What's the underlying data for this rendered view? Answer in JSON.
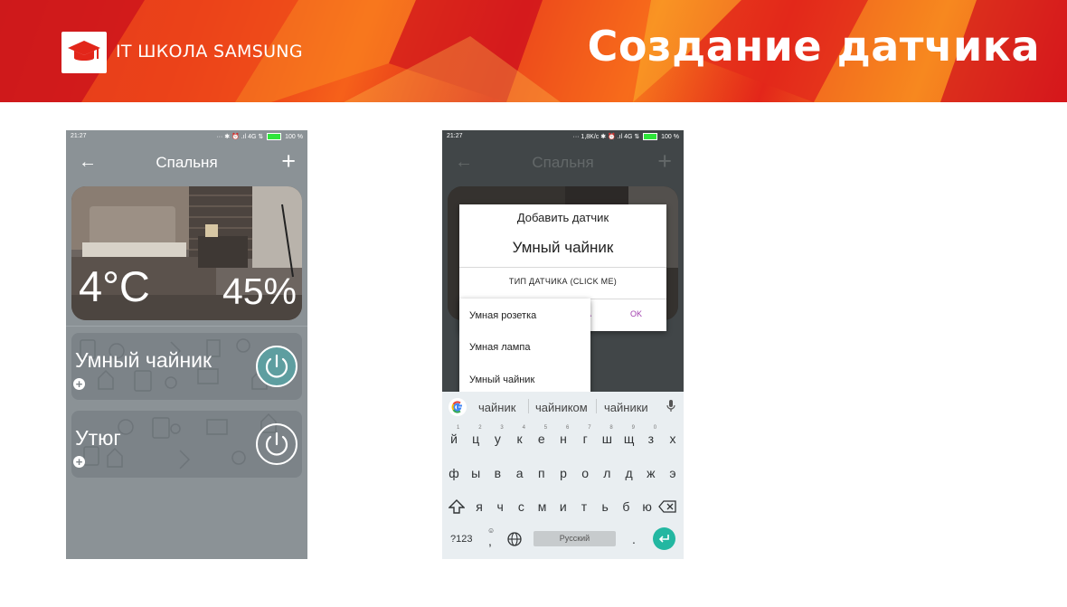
{
  "header": {
    "logo_text": "IT ШКОЛА SAMSUNG",
    "slide_title": "Создание датчика"
  },
  "phone1": {
    "status": {
      "time": "21:27",
      "icons": "··· ✱ ⏰ .ıl 4G ⇅",
      "battery": "100 %"
    },
    "appbar": {
      "back": "←",
      "title": "Спальня",
      "add": "+"
    },
    "room": {
      "temperature": "4°C",
      "humidity": "45%"
    },
    "devices": [
      {
        "name": "Умный чайник",
        "add": "+",
        "power_state": "on"
      },
      {
        "name": "Утюг",
        "add": "+",
        "power_state": "off"
      }
    ]
  },
  "phone2": {
    "status": {
      "time": "21:27",
      "icons": "··· 1,8K/c ✱ ⏰ .ıl 4G ⇅",
      "battery": "100 %"
    },
    "appbar": {
      "back": "←",
      "title": "Спальня",
      "add": "+"
    },
    "dialog": {
      "title": "Добавить датчик",
      "name": "Умный чайник",
      "type_button": "ТИП ДАТЧИКА (CLICK ME)",
      "cancel_partial": "А",
      "ok": "OK"
    },
    "dropdown": {
      "options": [
        "Умная розетка",
        "Умная лампа",
        "Умный чайник"
      ]
    },
    "keyboard": {
      "suggestions": [
        "чайник",
        "чайником",
        "чайники"
      ],
      "row1": [
        "й",
        "ц",
        "у",
        "к",
        "е",
        "н",
        "г",
        "ш",
        "щ",
        "з",
        "х"
      ],
      "row1_hints": [
        "1",
        "2",
        "3",
        "4",
        "5",
        "6",
        "7",
        "8",
        "9",
        "0",
        ""
      ],
      "row2": [
        "ф",
        "ы",
        "в",
        "а",
        "п",
        "р",
        "о",
        "л",
        "д",
        "ж",
        "э"
      ],
      "row3": [
        "я",
        "ч",
        "с",
        "м",
        "и",
        "т",
        "ь",
        "б",
        "ю"
      ],
      "symbols_key": "?123",
      "comma_key": ",",
      "space_label": "Русский",
      "period_key": "."
    }
  },
  "colors": {
    "accent_teal": "#23b7a1",
    "dialog_button": "#a23fae",
    "power_on": "#5e9ea0",
    "banner_red": "#e2261a"
  }
}
